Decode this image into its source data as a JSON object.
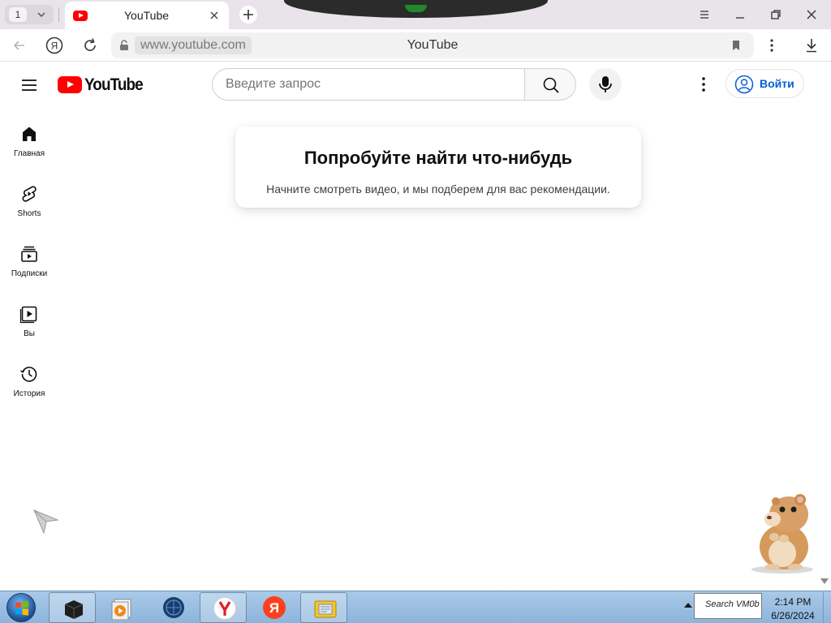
{
  "browser": {
    "tab_count": "1",
    "tab_title": "YouTube",
    "address_url": "www.youtube.com",
    "page_title": "YouTube"
  },
  "masthead": {
    "logo_text": "YouTube",
    "search_placeholder": "Введите запрос",
    "signin_label": "Войти"
  },
  "guide": {
    "items": [
      {
        "label": "Главная",
        "icon": "home-icon"
      },
      {
        "label": "Shorts",
        "icon": "shorts-icon"
      },
      {
        "label": "Подписки",
        "icon": "subscriptions-icon"
      },
      {
        "label": "Вы",
        "icon": "you-icon"
      },
      {
        "label": "История",
        "icon": "history-icon"
      }
    ]
  },
  "feed_nudge": {
    "title": "Попробуйте найти что-нибудь",
    "subtitle": "Начните смотреть видео, и мы подберем для вас рекомендации."
  },
  "taskbar": {
    "apps": [
      "virtualbox-icon",
      "media-player-icon",
      "browser-globe-icon",
      "yandex-browser-icon",
      "yandex-icon",
      "file-manager-icon"
    ],
    "tray_widget_text": "Search VM0b",
    "clock_time": "2:14 PM",
    "clock_date": "6/26/2024"
  },
  "colors": {
    "youtube_red": "#ff0000",
    "signin_blue": "#065fd4",
    "taskbar_blue": "#8db4dc"
  }
}
